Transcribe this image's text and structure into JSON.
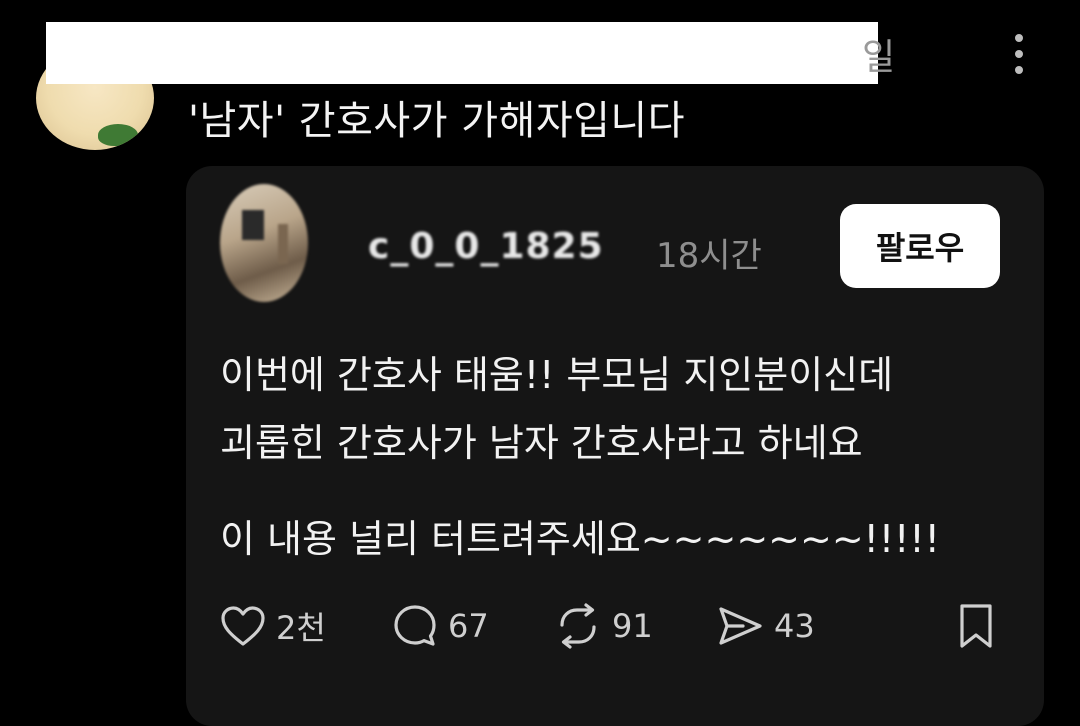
{
  "header": {
    "name_tail": "일",
    "post_text": "'남자' 간호사가 가해자입니다"
  },
  "quote": {
    "username": "c_0_0_1825",
    "time": "18시간",
    "follow_label": "팔로우",
    "lines": [
      "이번에 간호사 태움!! 부모님 지인분이신데",
      "괴롭힌 간호사가 남자 간호사라고 하네요",
      "이 내용 널리 터트려주세요~~~~~~~!!!!!"
    ],
    "actions": {
      "likes": "2천",
      "replies": "67",
      "reposts": "91",
      "shares": "43"
    }
  }
}
